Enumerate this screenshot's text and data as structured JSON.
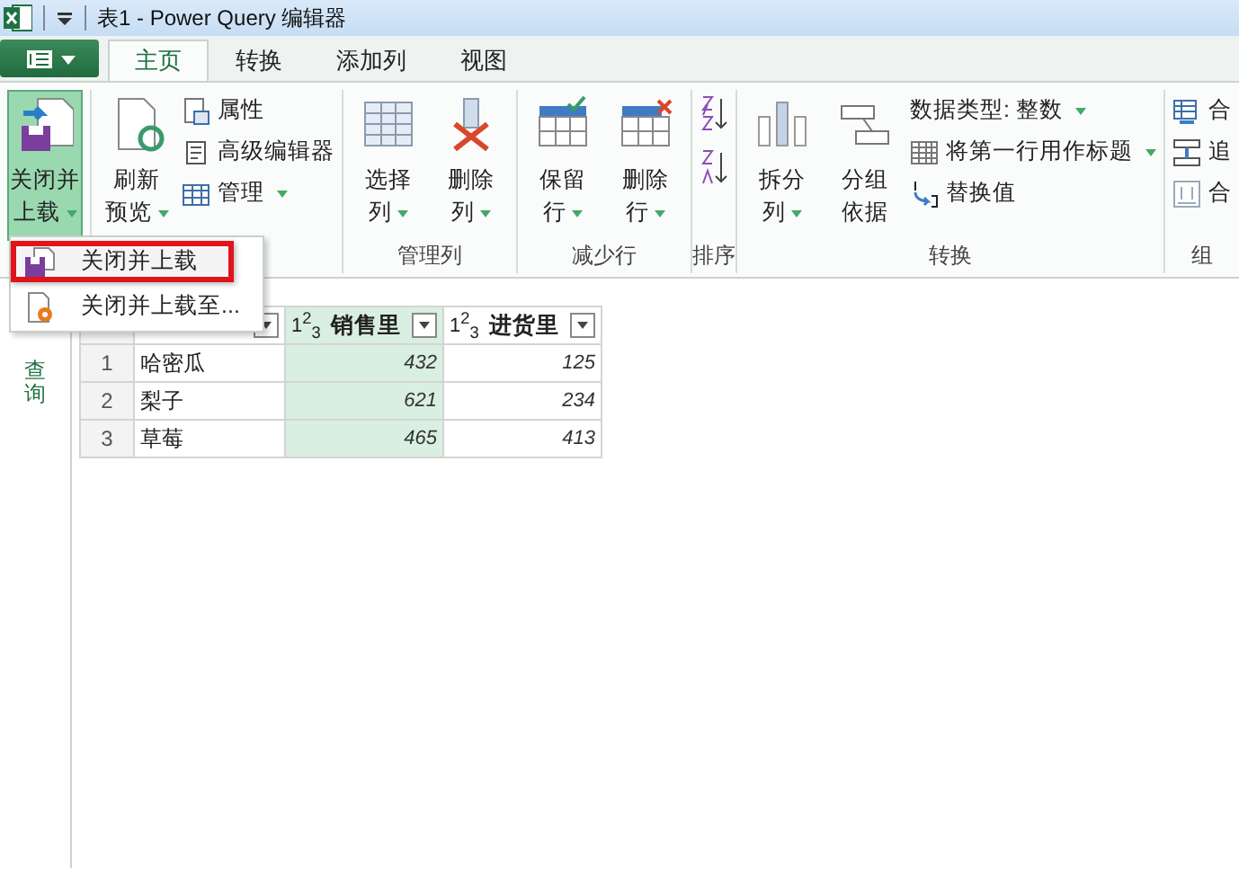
{
  "window": {
    "title": "表1 - Power Query 编辑器"
  },
  "tabs": [
    {
      "label": "主页",
      "selected": true
    },
    {
      "label": "转换",
      "selected": false
    },
    {
      "label": "添加列",
      "selected": false
    },
    {
      "label": "视图",
      "selected": false
    }
  ],
  "ribbon_groups": [
    {
      "items": [
        {
          "kind": "big",
          "lines": [
            "关闭并",
            "上载"
          ],
          "dropdown": true,
          "expanded": true
        }
      ]
    },
    {
      "items": [
        {
          "kind": "big",
          "lines": [
            "刷新",
            "预览"
          ],
          "dropdown": true,
          "expanded": false
        },
        {
          "kind": "stack",
          "items": [
            {
              "label": "属性",
              "dropdown": false
            },
            {
              "label": "高级编辑器",
              "dropdown": false
            },
            {
              "label": "管理",
              "dropdown": true
            }
          ]
        }
      ]
    },
    {
      "label": "管理列",
      "items": [
        {
          "kind": "big",
          "lines": [
            "选择",
            "列"
          ],
          "dropdown": true,
          "expanded": false
        },
        {
          "kind": "big",
          "lines": [
            "删除",
            "列"
          ],
          "dropdown": true,
          "expanded": false
        }
      ]
    },
    {
      "label": "减少行",
      "items": [
        {
          "kind": "big",
          "lines": [
            "保留",
            "行"
          ],
          "dropdown": true,
          "expanded": false
        },
        {
          "kind": "big",
          "lines": [
            "删除",
            "行"
          ],
          "dropdown": true,
          "expanded": false
        }
      ]
    },
    {
      "label": "排序",
      "items": [
        {
          "kind": "sort"
        }
      ]
    },
    {
      "label": "转换",
      "items": [
        {
          "kind": "big",
          "lines": [
            "拆分",
            "列"
          ],
          "dropdown": true,
          "expanded": false
        },
        {
          "kind": "big",
          "lines": [
            "分组",
            "依据"
          ],
          "dropdown": false,
          "expanded": false
        },
        {
          "kind": "stack",
          "items": [
            {
              "label": "数据类型: 整数",
              "dropdown": true
            },
            {
              "label": "将第一行用作标题",
              "dropdown": true
            },
            {
              "label": "替换值",
              "dropdown": false
            }
          ]
        }
      ]
    },
    {
      "label": "组",
      "items": [
        {
          "kind": "stack",
          "items": [
            {
              "label": "合",
              "dropdown": false
            },
            {
              "label": "追",
              "dropdown": false
            },
            {
              "label": "合",
              "dropdown": false
            }
          ]
        }
      ]
    }
  ],
  "menu": {
    "items": [
      {
        "label": "关闭并上载",
        "selected": true
      },
      {
        "label": "关闭并上载至...",
        "selected": false
      }
    ]
  },
  "sidebar": {
    "label": "查询"
  },
  "table": {
    "columns": [
      {
        "selected": false
      },
      {
        "label": "销售里",
        "type_label": "1$^{2}$$_{3}$",
        "selected": true
      },
      {
        "label": "进货里",
        "type_label": "1$^{2}$$_{3}$",
        "selected": false
      }
    ],
    "rows": [
      {
        "number": "1",
        "cells": [
          "哈密瓜",
          "432",
          "125"
        ]
      },
      {
        "number": "2",
        "cells": [
          "梨子",
          "621",
          "234"
        ]
      },
      {
        "number": "3",
        "cells": [
          "草莓",
          "465",
          "413"
        ]
      }
    ]
  }
}
